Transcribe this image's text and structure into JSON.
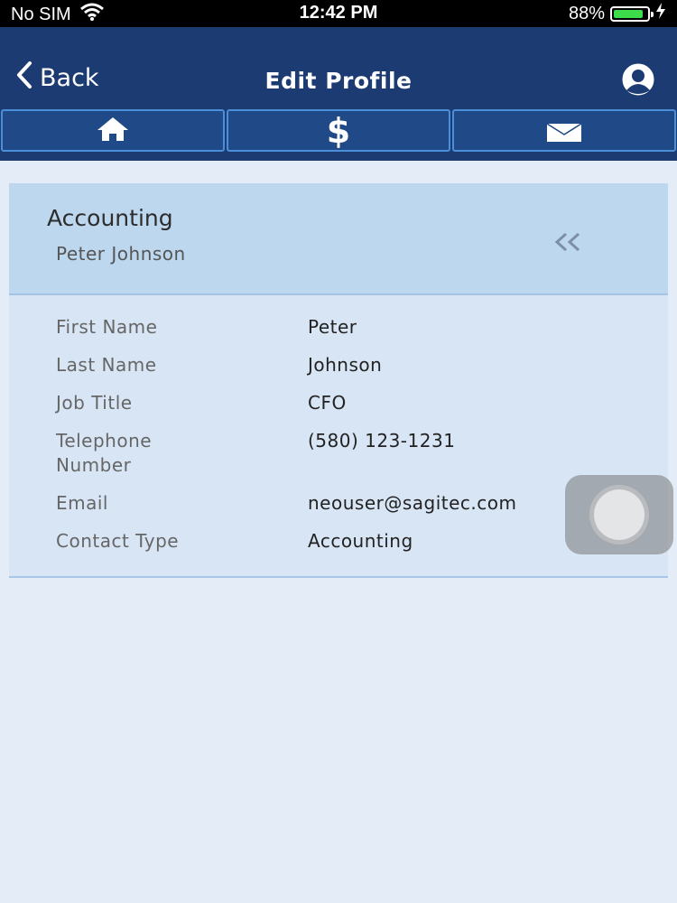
{
  "status_bar": {
    "carrier": "No SIM",
    "time": "12:42 PM",
    "battery_percent": "88%",
    "battery_level": 0.88
  },
  "nav": {
    "back_label": "Back",
    "title": "Edit Profile"
  },
  "tabs": [
    {
      "icon": "home-icon"
    },
    {
      "icon": "dollar-icon",
      "glyph": "$"
    },
    {
      "icon": "mail-icon"
    }
  ],
  "card": {
    "title": "Accounting",
    "subtitle": "Peter Johnson",
    "collapse_icon": "double-chevron-left-icon",
    "fields": [
      {
        "label": "First Name",
        "value": "Peter"
      },
      {
        "label": "Last Name",
        "value": "Johnson"
      },
      {
        "label": "Job Title",
        "value": "CFO"
      },
      {
        "label": "Telephone Number",
        "value": "(580) 123-1231"
      },
      {
        "label": "Email",
        "value": "neouser@sagitec.com"
      },
      {
        "label": "Contact Type",
        "value": "Accounting"
      }
    ]
  },
  "colors": {
    "nav_background": "#1b3b72",
    "tab_border": "#4a8fd8",
    "card_header": "#bdd7ef",
    "card_body": "#d7e5f4",
    "page_background": "#e4ecf7"
  }
}
